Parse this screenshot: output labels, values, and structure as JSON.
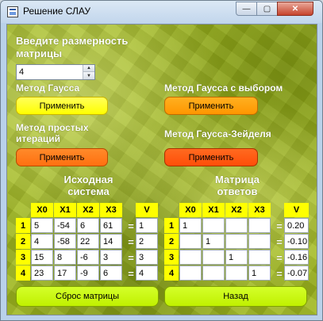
{
  "window": {
    "title": "Решение СЛАУ",
    "min_glyph": "—",
    "max_glyph": "▢",
    "close_glyph": "✕"
  },
  "size_label": "Введите размерность матрицы",
  "size_value": "4",
  "spin_up_glyph": "▲",
  "spin_down_glyph": "▼",
  "methods": {
    "gauss": {
      "label": "Метод Гаусса",
      "button": "Применить"
    },
    "gauss_pivot": {
      "label": "Метод Гаусса с выбором",
      "button": "Применить"
    },
    "simple_iter": {
      "label": "Метод простых итераций",
      "button": "Применить"
    },
    "seidel": {
      "label": "Метод Гаусса-Зейделя",
      "button": "Применить"
    }
  },
  "source": {
    "title": "Исходная система",
    "columns": [
      "X0",
      "X1",
      "X2",
      "X3"
    ],
    "v_header": "V",
    "row_labels": [
      "1",
      "2",
      "3",
      "4"
    ],
    "rows": [
      [
        "5",
        "-54",
        "6",
        "61"
      ],
      [
        "4",
        "-58",
        "22",
        "14"
      ],
      [
        "15",
        "8",
        "-6",
        "3"
      ],
      [
        "23",
        "17",
        "-9",
        "6"
      ]
    ],
    "v": [
      "1",
      "2",
      "3",
      "4"
    ]
  },
  "answer": {
    "title": "Матрица ответов",
    "columns": [
      "X0",
      "X1",
      "X2",
      "X3"
    ],
    "v_header": "V",
    "row_labels": [
      "1",
      "2",
      "3",
      "4"
    ],
    "rows": [
      [
        "1",
        "",
        "",
        ""
      ],
      [
        "",
        "1",
        "",
        ""
      ],
      [
        "",
        "",
        "1",
        ""
      ],
      [
        "",
        "",
        "",
        "1"
      ]
    ],
    "v": [
      "0.20",
      "-0.10",
      "-0.16",
      "-0.07"
    ]
  },
  "eq_sign": "=",
  "reset_button": "Сброс матрицы",
  "back_button": "Назад",
  "colors": {
    "background": "#9fb71f",
    "yellow": "#ffff00",
    "orange": "#ff9600",
    "orange_red": "#ff4e08",
    "lime": "#c0f000"
  }
}
